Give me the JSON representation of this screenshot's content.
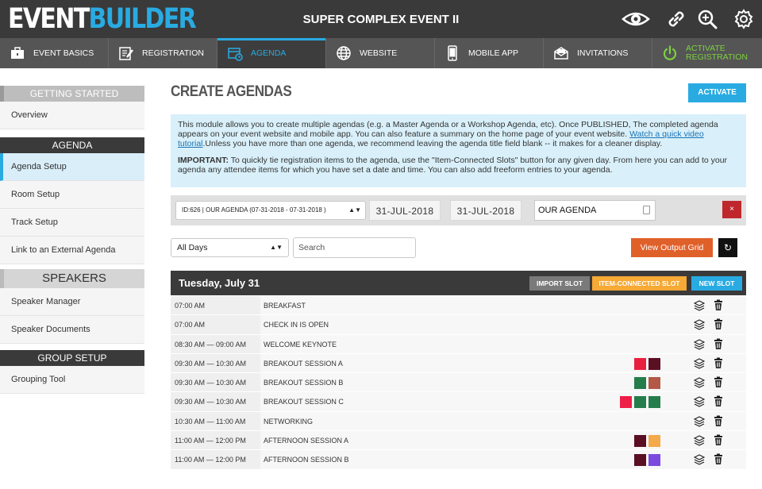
{
  "app": {
    "logo_part1": "EVENT",
    "logo_part2": "BUILDER",
    "event_title": "SUPER COMPLEX EVENT II"
  },
  "top_icons": [
    "eye-icon",
    "link-icon",
    "zoom-in-icon",
    "gear-icon"
  ],
  "nav": [
    {
      "label": "EVENT BASICS",
      "icon": "toolbox-icon"
    },
    {
      "label": "REGISTRATION",
      "icon": "edit-form-icon"
    },
    {
      "label": "AGENDA",
      "icon": "calendar-clock-icon",
      "active": true
    },
    {
      "label": "WEBSITE",
      "icon": "globe-icon"
    },
    {
      "label": "MOBILE APP",
      "icon": "mobile-icon"
    },
    {
      "label": "INVITATIONS",
      "icon": "envelope-icon"
    },
    {
      "label_line1": "ACTIVATE",
      "label_line2": "REGISTRATION",
      "icon": "power-icon"
    }
  ],
  "sidebar": {
    "getting_started": "GETTING STARTED",
    "overview": "Overview",
    "agenda_header": "AGENDA",
    "agenda_setup": "Agenda Setup",
    "room_setup": "Room Setup",
    "track_setup": "Track Setup",
    "external_agenda": "Link to an External Agenda",
    "speakers_header": "SPEAKERS",
    "speaker_manager": "Speaker Manager",
    "speaker_documents": "Speaker Documents",
    "group_header": "GROUP SETUP",
    "grouping_tool": "Grouping Tool"
  },
  "page": {
    "title": "CREATE AGENDAS",
    "activate_label": "ACTIVATE",
    "info_p1_before": "This module allows you to create multiple agendas (e.g. a Master Agenda or a Workshop Agenda, etc). Once PUBLISHED, The completed agenda appears on your event website and mobile app. You can also feature a summary on the home page of your event website. ",
    "info_link": "Watch a quick video tutorial",
    "info_p1_after": ".Unless you have more than one agenda, we recommend leaving the agenda title field blank -- it makes for a cleaner display.",
    "info_p2_strong": "IMPORTANT:",
    "info_p2": " To quickly tie registration items to the agenda, use the \"Item-Connected Slots\" button for any given day. From here you can add to your agenda any attendee items for which you have set a date and time. You can also add freeform entries to your agenda."
  },
  "selector": {
    "agenda_selected": "ID:626 | OUR AGENDA (07-31-2018 - 07-31-2018 )",
    "start_date": "31-JUL-2018",
    "end_date": "31-JUL-2018",
    "agenda_name": "OUR AGENDA",
    "close_symbol": "×"
  },
  "filters": {
    "day_selected": "All Days",
    "search_placeholder": "Search",
    "output_label": "View Output Grid",
    "refresh_symbol": "↻"
  },
  "day": {
    "title": "Tuesday, July 31",
    "import_label": "IMPORT SLOT",
    "item_connected_label": "ITEM-CONNECTED SLOT",
    "new_slot_label": "NEW SLOT"
  },
  "slots": [
    {
      "time": "07:00 AM",
      "title": "BREAKFAST",
      "colors": []
    },
    {
      "time": "07:00 AM",
      "title": "CHECK IN IS OPEN",
      "colors": []
    },
    {
      "time": "08:30 AM — 09:00 AM",
      "title": "WELCOME KEYNOTE",
      "colors": []
    },
    {
      "time": "09:30 AM — 10:30 AM",
      "title": "BREAKOUT SESSION A",
      "colors": [
        "#e8203f",
        "#5a0f23"
      ]
    },
    {
      "time": "09:30 AM — 10:30 AM",
      "title": "BREAKOUT SESSION B",
      "colors": [
        "#257d4c",
        "#b25a45"
      ]
    },
    {
      "time": "09:30 AM — 10:30 AM",
      "title": "BREAKOUT SESSION C",
      "colors": [
        "#ee1f47",
        "#257d4c",
        "#257d4c"
      ]
    },
    {
      "time": "10:30 AM — 11:00 AM",
      "title": "NETWORKING",
      "colors": []
    },
    {
      "time": "11:00 AM — 12:00 PM",
      "title": "AFTERNOON SESSION A",
      "colors": [
        "#5a0f23",
        "#f4a94a"
      ]
    },
    {
      "time": "11:00 AM — 12:00 PM",
      "title": "AFTERNOON SESSION B",
      "colors": [
        "#5a0f23",
        "#7b4be0"
      ]
    }
  ],
  "colors": {
    "accent": "#29abe2",
    "topbar": "#3a3a3a",
    "navbar": "#555555",
    "activate_green": "#7bd13f",
    "danger": "#c0272d",
    "output_orange": "#e0602a",
    "item_slot_orange": "#f6a935"
  }
}
